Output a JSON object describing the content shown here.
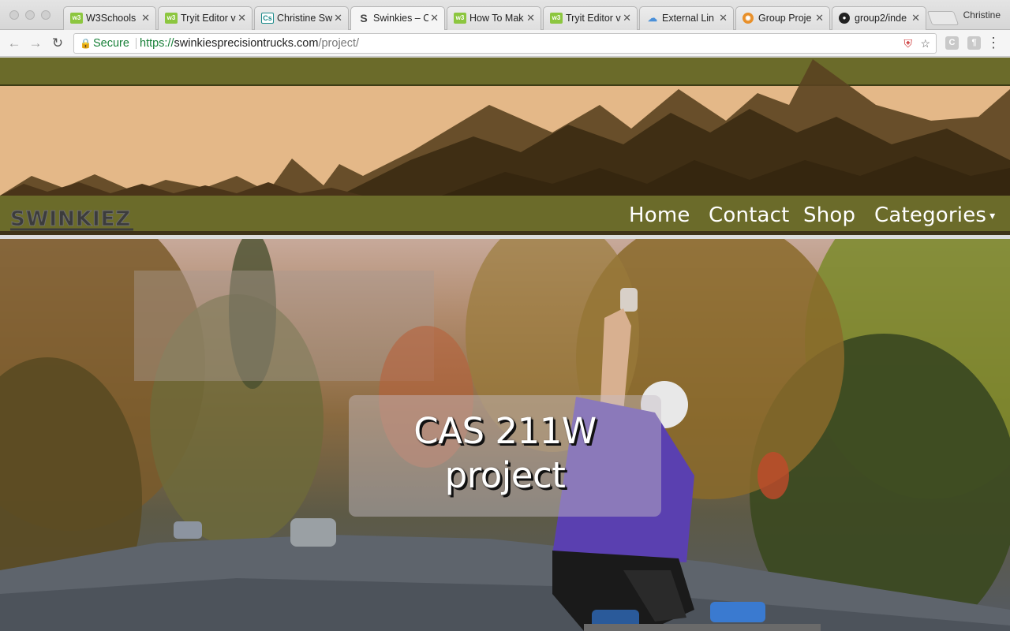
{
  "browser": {
    "tabs": [
      {
        "label": "W3Schools",
        "favicon": "w3"
      },
      {
        "label": "Tryit Editor v",
        "favicon": "w3"
      },
      {
        "label": "Christine Sw",
        "favicon": "cs"
      },
      {
        "label": "Swinkies – C",
        "favicon": "sw",
        "active": true
      },
      {
        "label": "How To Mak",
        "favicon": "w3"
      },
      {
        "label": "Tryit Editor v",
        "favicon": "w3"
      },
      {
        "label": "External Lin",
        "favicon": "ext"
      },
      {
        "label": "Group Proje",
        "favicon": "gp"
      },
      {
        "label": "group2/inde",
        "favicon": "gh"
      }
    ],
    "profile_name": "Christine",
    "secure_label": "Secure",
    "url_scheme": "https://",
    "url_host": "swinkiesprecisiontrucks.com",
    "url_path": "/project/",
    "extension_1": "C",
    "extension_2": "¶"
  },
  "site": {
    "logo_text": "SWINKIEZ",
    "nav": {
      "home": "Home",
      "contact": "Contact",
      "shop": "Shop",
      "categories": "Categories"
    },
    "hero": {
      "title_line_1": "CAS 211W",
      "title_line_2": "project"
    }
  },
  "colors": {
    "olive": "#6b6b2a",
    "banner_sand": "#e4b888",
    "mountain_dark": "#3f2e14",
    "secure_green": "#188038"
  }
}
